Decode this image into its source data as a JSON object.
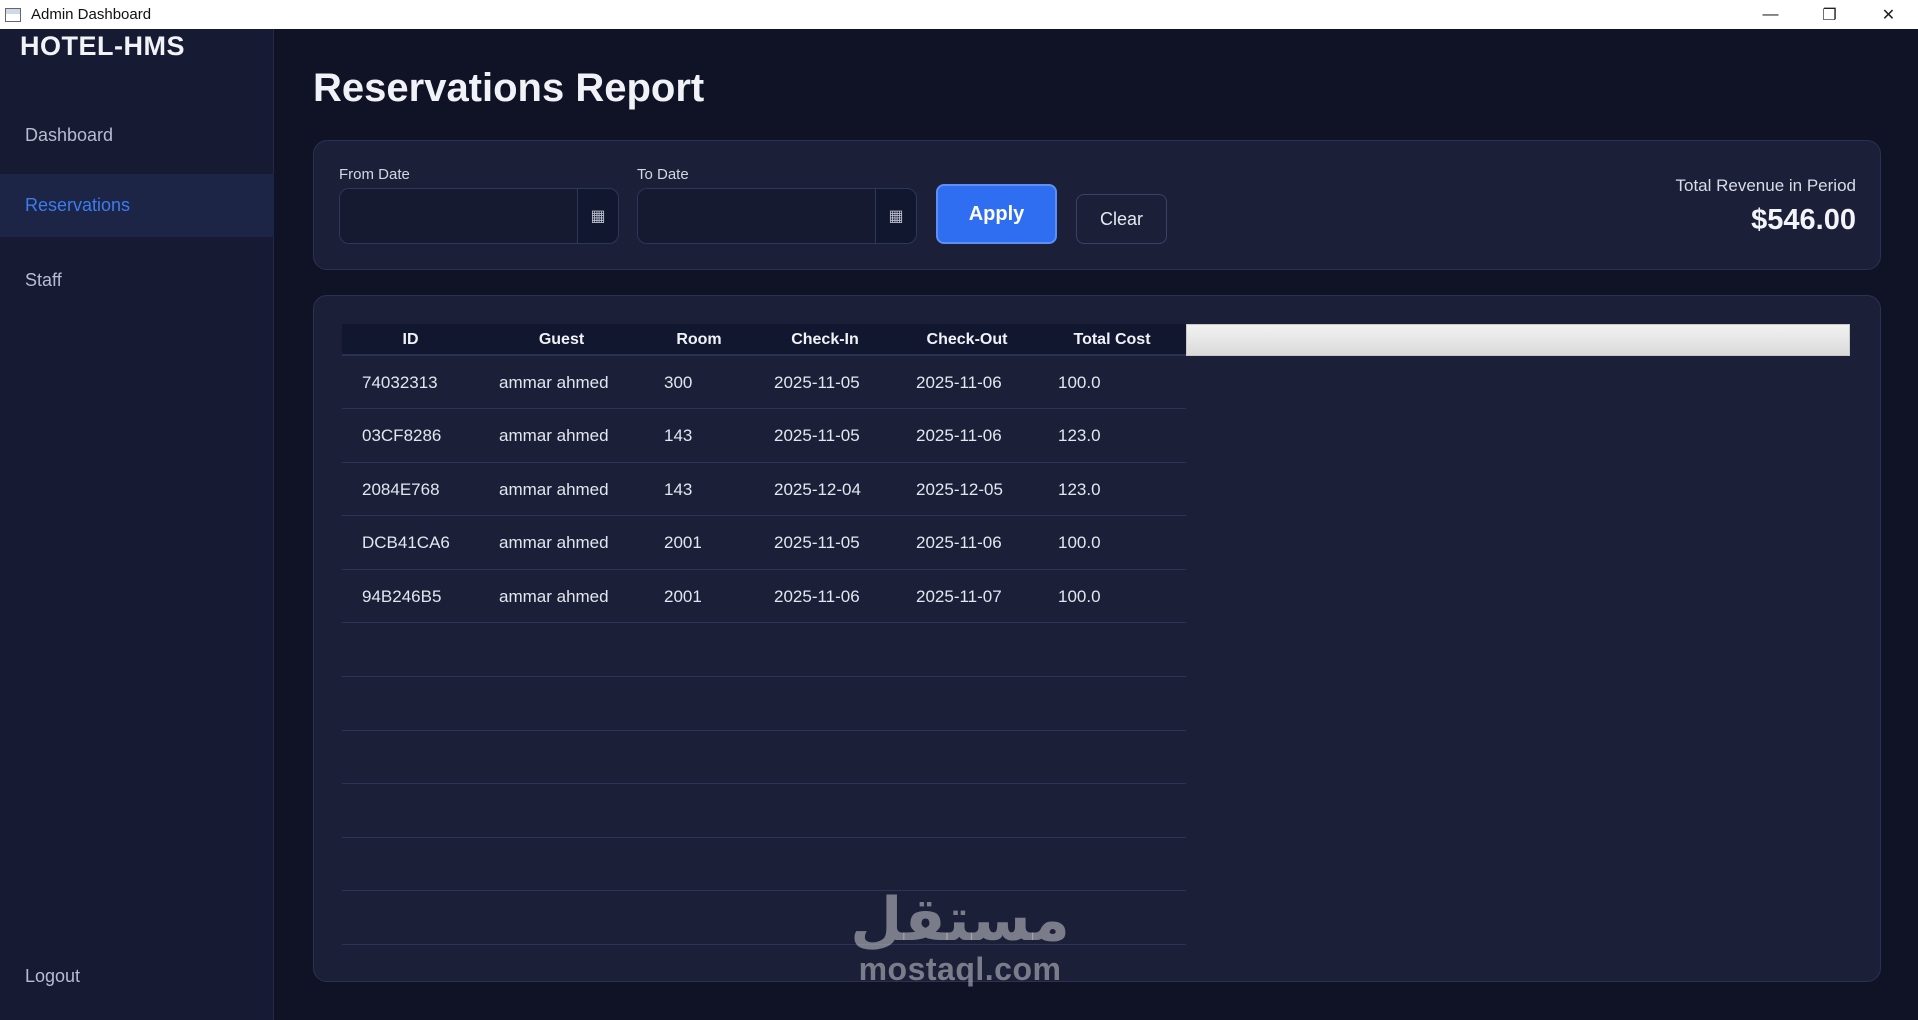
{
  "window": {
    "title": "Admin Dashboard",
    "controls": {
      "minimize": "—",
      "restore": "❐",
      "close": "✕"
    }
  },
  "sidebar": {
    "brand": "HOTEL-HMS",
    "items": [
      {
        "label": "Dashboard",
        "active": false
      },
      {
        "label": "Reservations",
        "active": true
      },
      {
        "label": "Staff",
        "active": false
      }
    ],
    "logout_label": "Logout"
  },
  "page": {
    "title": "Reservations Report"
  },
  "filters": {
    "from_label": "From Date",
    "from_value": "",
    "to_label": "To Date",
    "to_value": "",
    "calendar_icon": "▦",
    "apply_label": "Apply",
    "clear_label": "Clear",
    "revenue_label": "Total Revenue in Period",
    "revenue_value": "$546.00"
  },
  "table": {
    "columns": [
      "ID",
      "Guest",
      "Room",
      "Check-In",
      "Check-Out",
      "Total Cost"
    ],
    "rows": [
      [
        "74032313",
        "ammar ahmed",
        "300",
        "2025-11-05",
        "2025-11-06",
        "100.0"
      ],
      [
        "03CF8286",
        "ammar ahmed",
        "143",
        "2025-11-05",
        "2025-11-06",
        "123.0"
      ],
      [
        "2084E768",
        "ammar ahmed",
        "143",
        "2025-12-04",
        "2025-12-05",
        "123.0"
      ],
      [
        "DCB41CA6",
        "ammar ahmed",
        "2001",
        "2025-11-05",
        "2025-11-06",
        "100.0"
      ],
      [
        "94B246B5",
        "ammar ahmed",
        "2001",
        "2025-11-06",
        "2025-11-07",
        "100.0"
      ]
    ]
  },
  "watermark": {
    "arabic": "مستقل",
    "latin": "mostaql.com"
  },
  "colors": {
    "accent": "#2f6ef0",
    "active_nav_text": "#3d7bf0",
    "background": "#0f1325",
    "sidebar": "#161b33",
    "card": "#1b2038"
  }
}
